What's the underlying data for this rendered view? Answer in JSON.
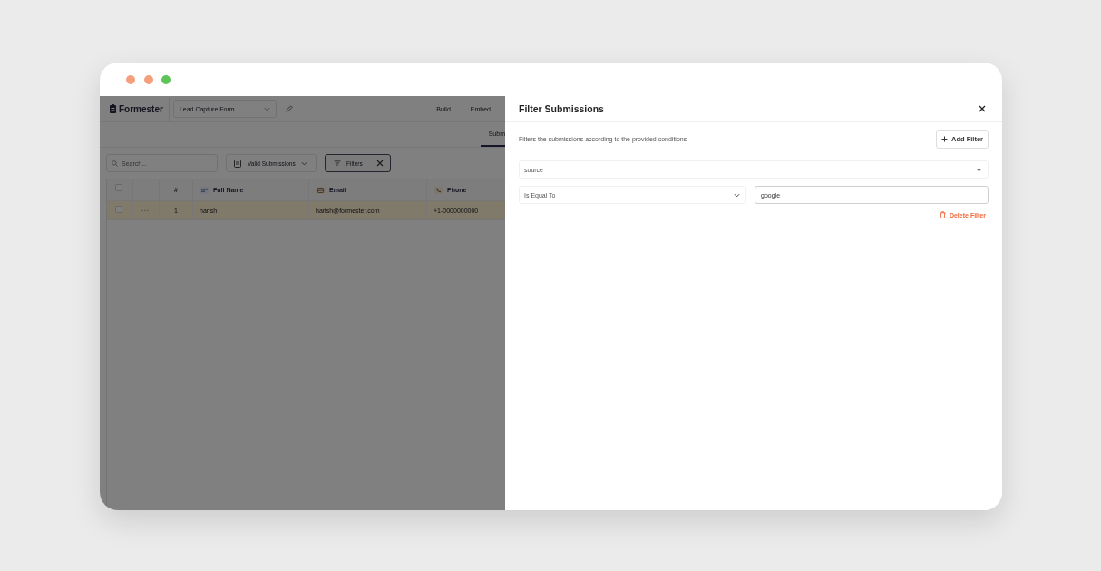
{
  "window": {
    "controls": [
      {
        "color": "#f4a07e"
      },
      {
        "color": "#f4a07e"
      },
      {
        "color": "#5ec45a"
      }
    ]
  },
  "app": {
    "logo": "Formester",
    "form_select": {
      "value": "Lead Capture Form"
    },
    "nav": [
      {
        "label": "Build"
      },
      {
        "label": "Embed"
      }
    ],
    "tabs": [
      {
        "label": "Subm",
        "selected": true
      }
    ],
    "search": {
      "placeholder": "Search..."
    },
    "view_select": {
      "value": "Valid Submissions"
    },
    "filters_button": {
      "label": "Filters",
      "active": true
    },
    "table": {
      "header_checkbox": {
        "checked": false
      },
      "columns": [
        {
          "label": "#",
          "kind": "index"
        },
        {
          "label": "Full Name",
          "kind": "text"
        },
        {
          "label": "Email",
          "kind": "email"
        },
        {
          "label": "Phone",
          "kind": "phone"
        }
      ],
      "rows": [
        {
          "checked": false,
          "highlighted": true,
          "cells": [
            "1",
            "harish",
            "harish@formester.com",
            "+1-0000000000"
          ]
        }
      ]
    }
  },
  "drawer": {
    "title": "Filter Submissions",
    "description": "Filters the submissions according to the provided conditions",
    "add_button": "Add Filter",
    "filters": [
      {
        "field": "source",
        "operator": "Is Equal To",
        "value": "google",
        "delete_label": "Delete Filter"
      }
    ]
  }
}
